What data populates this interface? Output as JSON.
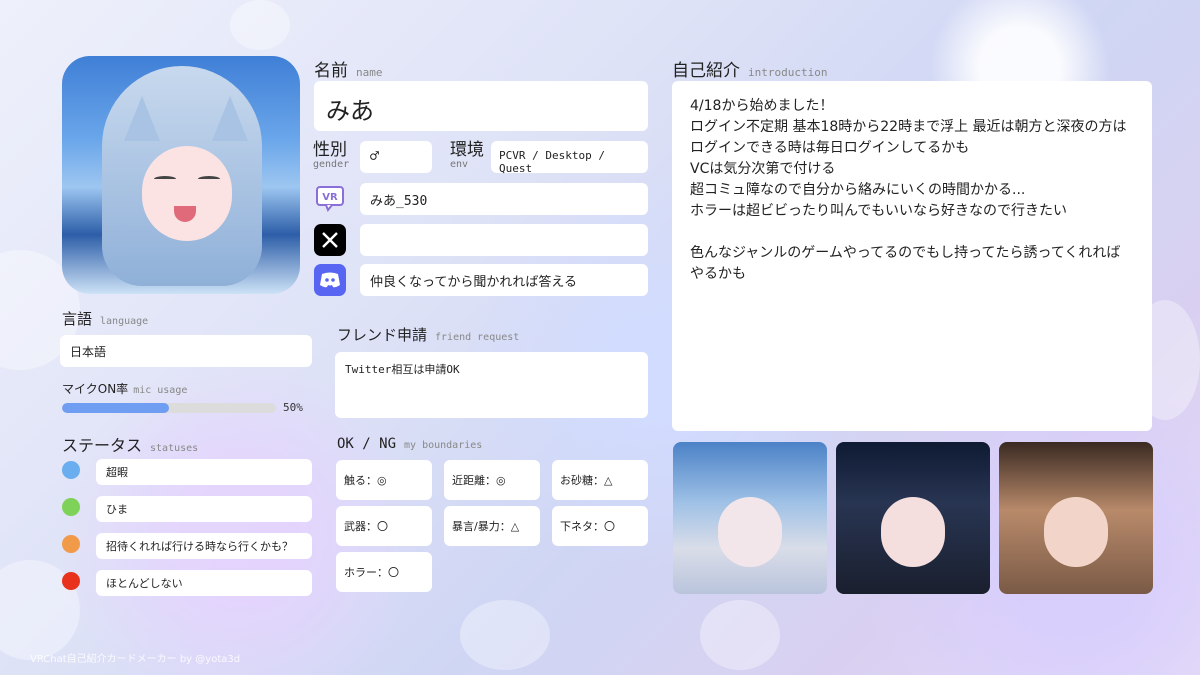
{
  "profile": {
    "name_label": "名前",
    "name_label_en": "name",
    "name": "みあ",
    "gender_label": "性別",
    "gender_label_en": "gender",
    "gender": "♂",
    "env_label": "環境",
    "env_label_en": "env",
    "env": "PCVR / Desktop / Quest",
    "vrchat_id": "みあ_530",
    "x_id": "",
    "discord": "仲良くなってから聞かれれば答える"
  },
  "language": {
    "label": "言語",
    "label_en": "language",
    "value": "日本語"
  },
  "mic": {
    "label": "マイクON率",
    "label_en": "mic usage",
    "percent": 50,
    "percent_text": "50%"
  },
  "statuses": {
    "label": "ステータス",
    "label_en": "statuses",
    "items": [
      {
        "color": "#6aaef0",
        "text": "超暇"
      },
      {
        "color": "#7ed25a",
        "text": "ひま"
      },
      {
        "color": "#f09a4a",
        "text": "招待くれれば行ける時なら行くかも？"
      },
      {
        "color": "#e8321e",
        "text": "ほとんどしない"
      }
    ]
  },
  "friend_request": {
    "label": "フレンド申請",
    "label_en": "friend request",
    "text": "Twitter相互は申請OK"
  },
  "boundaries": {
    "label": "OK / NG",
    "label_en": "my boundaries",
    "items": [
      "触る：◎",
      "近距離：◎",
      "お砂糖：△",
      "武器：〇",
      "暴言/暴力：△",
      "下ネタ：〇",
      "ホラー：〇"
    ]
  },
  "intro": {
    "label": "自己紹介",
    "label_en": "introduction",
    "text": "4/18から始めました！\nログイン不定期 基本18時から22時まで浮上 最近は朝方と深夜の方はログインできる時は毎日ログインしてるかも\nVCは気分次第で付ける\n超コミュ障なので自分から絡みにいくの時間かかる...\nホラーは超ビビったり叫んでもいいなら好きなので行きたい\n\n色んなジャンルのゲームやってるのでもし持ってたら誘ってくれればやるかも"
  },
  "icons": {
    "vrchat": "vrchat-icon",
    "x": "x-logo-icon",
    "discord": "discord-icon"
  },
  "colors": {
    "mic_bar": "#6f9df2",
    "mic_track": "#dcdcdc",
    "discord": "#5865f2",
    "vrchat": "#8a6fd9"
  },
  "footer": "VRChat自己紹介カードメーカー by @yota3d"
}
